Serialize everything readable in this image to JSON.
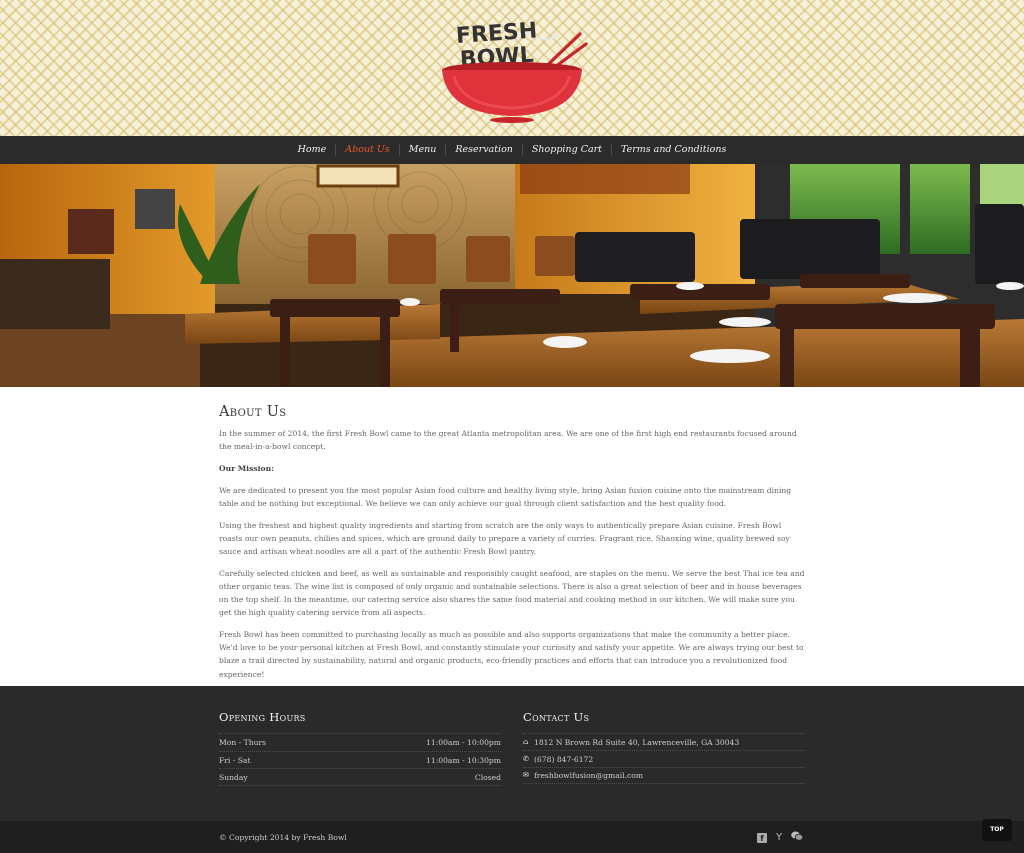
{
  "brand": {
    "logo_line1": "FRESH",
    "logo_line2": "BOWL"
  },
  "nav": {
    "items": [
      {
        "label": "Home",
        "active": false
      },
      {
        "label": "About Us",
        "active": true
      },
      {
        "label": "Menu",
        "active": false
      },
      {
        "label": "Reservation",
        "active": false
      },
      {
        "label": "Shopping Cart",
        "active": false
      },
      {
        "label": "Terms and Conditions",
        "active": false
      }
    ]
  },
  "about": {
    "title": "About Us",
    "intro": "In the summer of 2014, the first Fresh Bowl came to the great Atlanta metropolitan area. We are one of the first high end restaurants focused around the meal-in-a-bowl concept.",
    "mission_label": "Our Mission:",
    "p1": "We are dedicated to present you the most popular Asian food culture and healthy living style, bring Asian fusion cuisine onto the mainstream dining table and be nothing but exceptional. We believe we can only achieve our goal through client satisfaction and the best quality food.",
    "p2": "Using the freshest and highest quality ingredients and starting from scratch are the only ways to authentically prepare Asian cuisine. Fresh Bowl roasts our own peanuts, chilies and spices, which are ground daily to prepare a variety of curries. Fragrant rice, Shaoxing wine, quality brewed soy sauce and artisan wheat noodles are all a part of the authentic Fresh Bowl pantry.",
    "p3": "Carefully selected chicken and beef, as well as sustainable and responsibly caught seafood, are staples on the menu. We serve the best Thai ice tea and other organic teas. The wine list is composed of only organic and sustainable selections. There is also a great selection of beer and in house beverages on the top shelf. In the meantime, our catering service also shares the same food material and cooking method in our kitchen. We will make sure you get the high quality catering service from all aspects.",
    "p4": "Fresh Bowl has been committed to purchasing locally as much as possible and also supports organizations that make the community a better place. We'd love to be your personal kitchen at Fresh Bowl, and constantly stimulate your curiosity and satisfy your appetite. We are always trying our best to blaze a trail directed by sustainability, natural and organic products, eco-friendly practices and efforts that can introduce you a revolutionized food experience!"
  },
  "hours": {
    "title": "Opening Hours",
    "rows": [
      {
        "day": "Mon - Thurs",
        "time": "11:00am - 10:00pm"
      },
      {
        "day": "Fri - Sat",
        "time": "11:00am - 10:30pm"
      },
      {
        "day": "Sunday",
        "time": "Closed"
      }
    ]
  },
  "contact": {
    "title": "Contact Us",
    "address": "1812 N Brown Rd Suite 40, Lawrenceville, GA 30043",
    "phone": "(678) 847-6172",
    "email": "freshbowlfusion@gmail.com"
  },
  "footer": {
    "copyright": "© Copyright 2014 by Fresh Bowl",
    "top_label": "TOP"
  },
  "colors": {
    "accent": "#e8562a",
    "nav_bg": "#2b2b2b",
    "footer_bg": "#2a2a2a",
    "bottom_bg": "#1f1f1f"
  }
}
